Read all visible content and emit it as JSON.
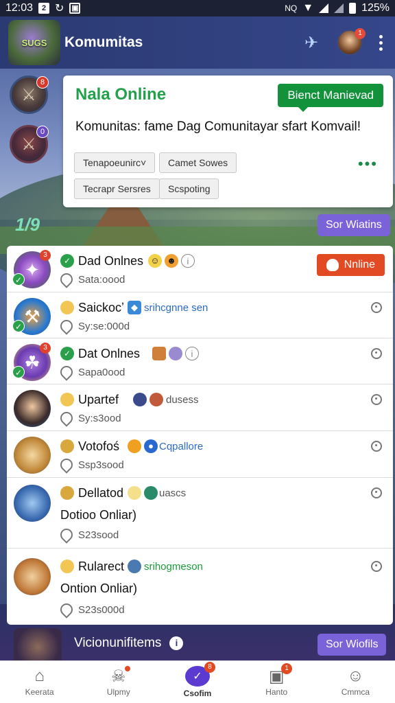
{
  "status_bar": {
    "time": "12:03",
    "icon_a": "2",
    "battery": "125%"
  },
  "app_bar": {
    "logo_text": "SUGS",
    "title": "Komumitas",
    "avatar_badge": "1"
  },
  "rail": {
    "items": [
      {
        "badge": "8"
      },
      {
        "badge": "0"
      }
    ],
    "count": "1/9"
  },
  "hero": {
    "title": "Nala Online",
    "badge": "Bienct Manievad",
    "text": "Komunitas: fame Dag Comunitayar sfart Komvail!",
    "chips": [
      "Tenapoeunirc˅",
      "Camet Sowes",
      "Tecrapr Sersres",
      "Scspoting"
    ],
    "more": "•••"
  },
  "sor_wiatins": "Sor Wiatins",
  "list": {
    "rows": [
      {
        "name": "Dad Onlnes",
        "sub": "Sata:oood",
        "button": "Nnline",
        "badge": "3"
      },
      {
        "name": "Saickocʼ",
        "extra": "srihcgnne sen",
        "sub": "Sy:se:000d"
      },
      {
        "name": "Dat Onlnes",
        "sub": "Sapa0ood",
        "badge": "3"
      },
      {
        "name": "Upartef",
        "extra": "dusess",
        "sub": "Sy:s3ood"
      },
      {
        "name": "Votofoś",
        "extra": "Cqpallore",
        "sub": "Ssp3sood"
      },
      {
        "name": "Dellatod",
        "extra": "uascs",
        "line2": "Dotioo Onliar)",
        "sub": "S23sood"
      },
      {
        "name": "Rularect",
        "extra": "srihogmeson",
        "line2": "Ontion Onliar)",
        "sub": "S23s000d"
      }
    ]
  },
  "footer": {
    "title": "Vicionunifitems",
    "button": "Sor Wiofils"
  },
  "bottom_nav": [
    {
      "label": "Keerata",
      "icon": "home-icon"
    },
    {
      "label": "Ulpmy",
      "icon": "figure-icon"
    },
    {
      "label": "Csofim",
      "icon": "chat-icon",
      "badge": "8"
    },
    {
      "label": "Hanto",
      "icon": "gallery-icon",
      "badge": "1"
    },
    {
      "label": "Cmmca",
      "icon": "person-icon"
    }
  ],
  "colors": {
    "accent_green": "#13923c",
    "accent_purple": "#7a62d8",
    "online_red": "#e24a24",
    "header_blue": "#2b3a72"
  }
}
